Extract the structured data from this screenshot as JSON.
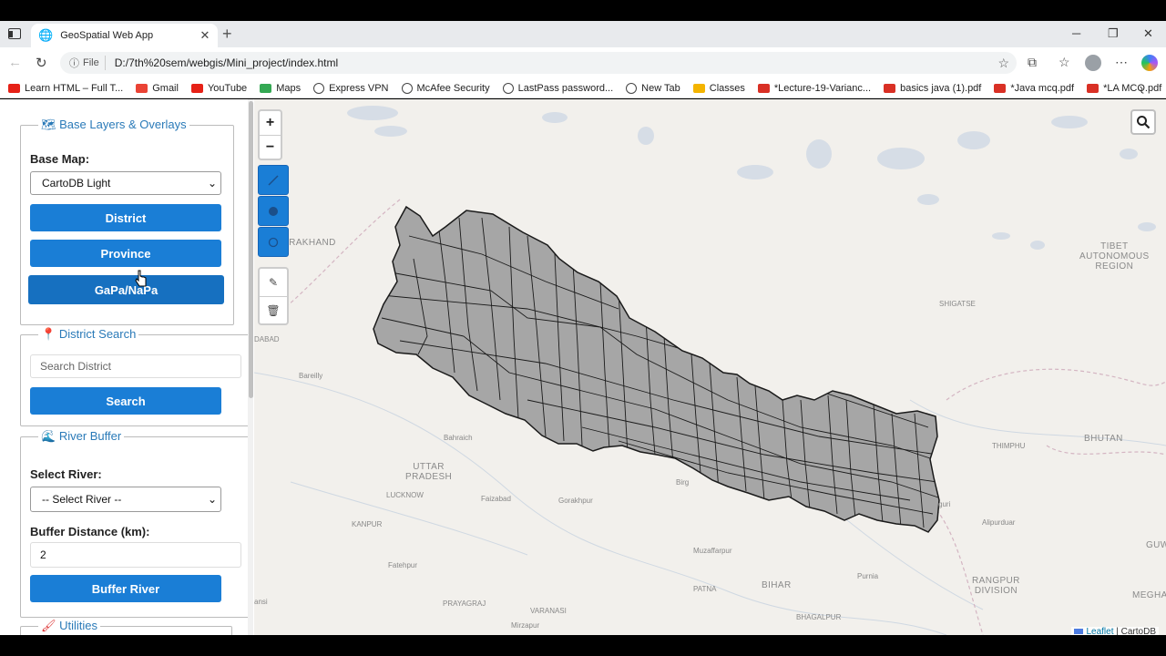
{
  "browser": {
    "tab_title": "GeoSpatial Web App",
    "file_chip": "File",
    "url": "D:/7th%20sem/webgis/Mini_project/index.html",
    "bookmarks": [
      {
        "label": "Learn HTML – Full T...",
        "color": "#e62117"
      },
      {
        "label": "Gmail",
        "color": "#ea4335"
      },
      {
        "label": "YouTube",
        "color": "#e62117"
      },
      {
        "label": "Maps",
        "color": "#34a853"
      },
      {
        "label": "Express VPN",
        "color": ""
      },
      {
        "label": "McAfee Security",
        "color": ""
      },
      {
        "label": "LastPass password...",
        "color": ""
      },
      {
        "label": "New Tab",
        "color": ""
      },
      {
        "label": "Classes",
        "color": "#f4b400"
      },
      {
        "label": "*Lecture-19-Varianc...",
        "color": "#d93025"
      },
      {
        "label": "basics java (1).pdf",
        "color": "#d93025"
      },
      {
        "label": "*Java mcq.pdf",
        "color": "#d93025"
      },
      {
        "label": "*LA MCQ.pdf",
        "color": "#d93025"
      }
    ]
  },
  "sidebar": {
    "base_layers": {
      "legend_icon": "world-map-icon",
      "legend": "Base Layers & Overlays",
      "base_map_label": "Base Map:",
      "base_map_selected": "CartoDB Light",
      "buttons": [
        "District",
        "Province",
        "GaPa/NaPa"
      ]
    },
    "district_search": {
      "legend_icon": "pin-icon",
      "legend": "District Search",
      "placeholder": "Search District",
      "button": "Search"
    },
    "river_buffer": {
      "legend_icon": "wave-icon",
      "legend": "River Buffer",
      "select_label": "Select River:",
      "select_value": "-- Select River --",
      "distance_label": "Buffer Distance (km):",
      "distance_value": "2",
      "button": "Buffer River"
    },
    "utilities": {
      "legend_icon": "brush-icon",
      "legend": "Utilities"
    }
  },
  "map": {
    "labels": {
      "uttarakhand": "ARAKHAND",
      "tibet": "TIBET\nAUTONOMOUS\nREGION",
      "shigatse": "SHIGATSE",
      "dabad": "DABAD",
      "bareilly": "Bareilly",
      "bahraich": "Bahraich",
      "uttar_pradesh": "UTTAR\nPRADESH",
      "lucknow": "LUCKNOW",
      "faizabad": "Faizabad",
      "gorakhpur": "Gorakhpur",
      "kanpur": "KANPUR",
      "fatehpur": "Fatehpur",
      "prayagraj": "PRAYAGRAJ",
      "varanasi": "VARANASI",
      "mirzapur": "Mirzapur",
      "ansi": "ansi",
      "muzaffarpur": "Muzaffarpur",
      "patna": "PATNA",
      "bihar": "BIHAR",
      "bhagalpur": "BHAGALPUR",
      "purnia": "Purnia",
      "alipurduar": "Alipurduar",
      "rangpur": "RANGPUR\nDIVISION",
      "thimphu": "THIMPHU",
      "bhutan": "BHUTAN",
      "guwa": "GUWA",
      "meghal": "MEGHAL",
      "birg": "Birg",
      "guri": "guri"
    },
    "attribution_leaflet": "Leaflet",
    "attribution_sep": " | ",
    "attribution_carto": "CartoDB",
    "polygon_fill": "#a6a6a6",
    "polygon_stroke": "#1a1a1a"
  }
}
